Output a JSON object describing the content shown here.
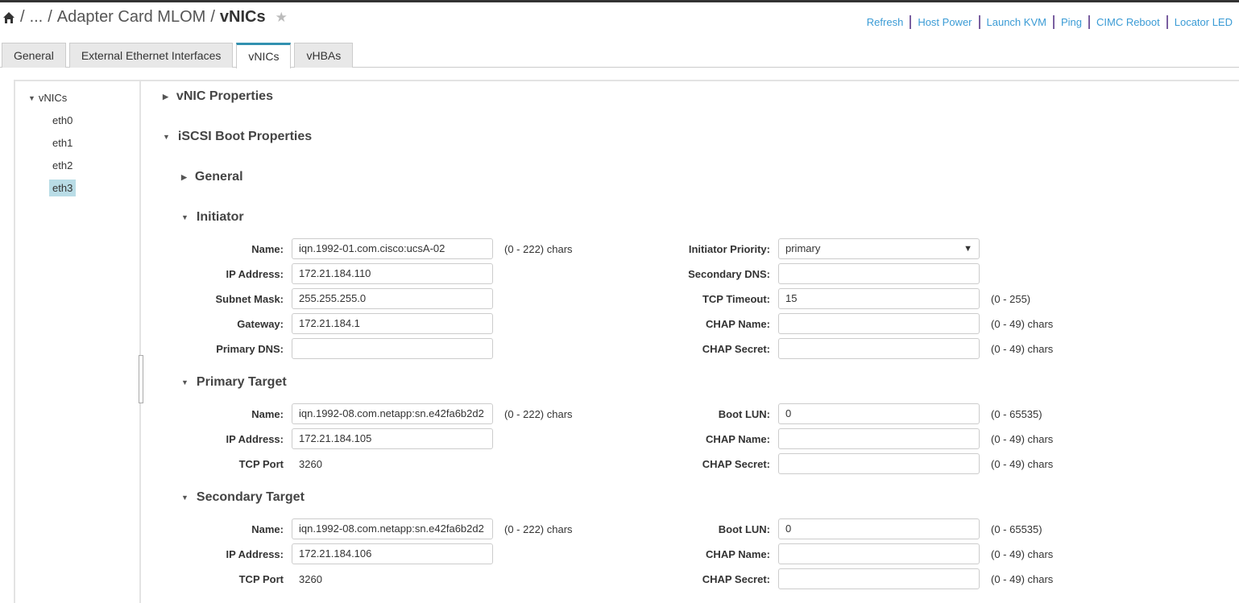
{
  "breadcrumb": {
    "home_icon": "home-icon",
    "ellipsis": "...",
    "parent": "Adapter Card MLOM",
    "current": "vNICs"
  },
  "actions": [
    "Refresh",
    "Host Power",
    "Launch KVM",
    "Ping",
    "CIMC Reboot",
    "Locator LED"
  ],
  "tabs": [
    {
      "label": "General"
    },
    {
      "label": "External Ethernet Interfaces"
    },
    {
      "label": "vNICs",
      "active": true
    },
    {
      "label": "vHBAs"
    }
  ],
  "tree": {
    "root": "vNICs",
    "items": [
      "eth0",
      "eth1",
      "eth2",
      "eth3"
    ],
    "selected": "eth3"
  },
  "sections": {
    "vnic_properties": "vNIC Properties",
    "iscsi_boot": "iSCSI Boot Properties",
    "general": "General",
    "initiator": "Initiator",
    "primary_target": "Primary Target",
    "secondary_target": "Secondary Target"
  },
  "initiator": {
    "rows": [
      {
        "label": "Name:",
        "value": "iqn.1992-01.com.cisco:ucsA-02",
        "hint": "(0 - 222) chars",
        "rlabel": "Initiator Priority:",
        "rvalue": "primary",
        "rselect": true,
        "rhint": ""
      },
      {
        "label": "IP Address:",
        "value": "172.21.184.110",
        "hint": "",
        "rlabel": "Secondary DNS:",
        "rvalue": "",
        "rhint": ""
      },
      {
        "label": "Subnet Mask:",
        "value": "255.255.255.0",
        "hint": "",
        "rlabel": "TCP Timeout:",
        "rvalue": "15",
        "rhint": "(0 - 255)"
      },
      {
        "label": "Gateway:",
        "value": "172.21.184.1",
        "hint": "",
        "rlabel": "CHAP Name:",
        "rvalue": "",
        "rhint": "(0 - 49) chars"
      },
      {
        "label": "Primary DNS:",
        "value": "",
        "hint": "",
        "rlabel": "CHAP Secret:",
        "rvalue": "",
        "rhint": "(0 - 49) chars"
      }
    ]
  },
  "primary_target": {
    "rows": [
      {
        "label": "Name:",
        "value": "iqn.1992-08.com.netapp:sn.e42fa6b2d2",
        "hint": "(0 - 222) chars",
        "rlabel": "Boot LUN:",
        "rvalue": "0",
        "rhint": "(0 - 65535)"
      },
      {
        "label": "IP Address:",
        "value": "172.21.184.105",
        "hint": "",
        "rlabel": "CHAP Name:",
        "rvalue": "",
        "rhint": "(0 - 49) chars"
      },
      {
        "label": "TCP Port",
        "value": "3260",
        "readonly": true,
        "hint": "",
        "rlabel": "CHAP Secret:",
        "rvalue": "",
        "rhint": "(0 - 49) chars"
      }
    ]
  },
  "secondary_target": {
    "rows": [
      {
        "label": "Name:",
        "value": "iqn.1992-08.com.netapp:sn.e42fa6b2d2",
        "hint": "(0 - 222) chars",
        "rlabel": "Boot LUN:",
        "rvalue": "0",
        "rhint": "(0 - 65535)"
      },
      {
        "label": "IP Address:",
        "value": "172.21.184.106",
        "hint": "",
        "rlabel": "CHAP Name:",
        "rvalue": "",
        "rhint": "(0 - 49) chars"
      },
      {
        "label": "TCP Port",
        "value": "3260",
        "readonly": true,
        "hint": "",
        "rlabel": "CHAP Secret:",
        "rvalue": "",
        "rhint": "(0 - 49) chars"
      }
    ]
  }
}
